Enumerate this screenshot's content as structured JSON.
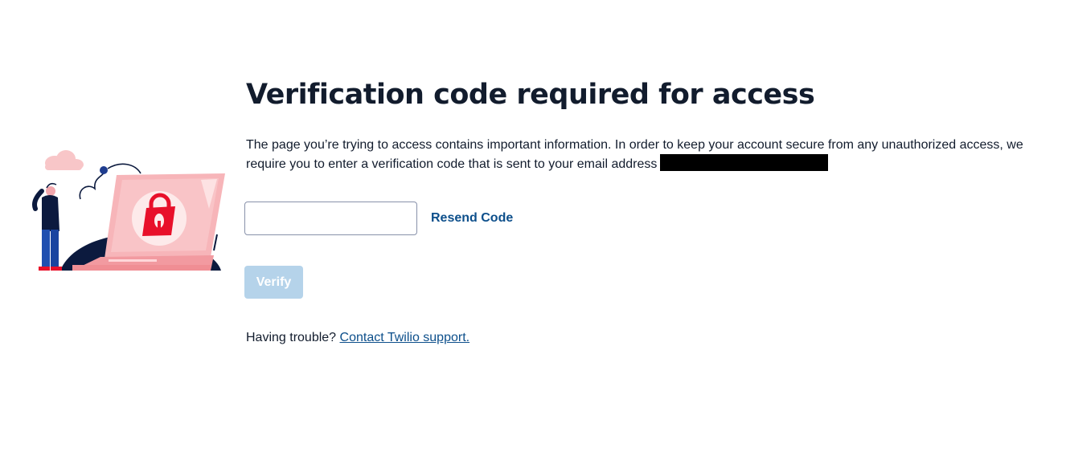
{
  "page": {
    "title": "Verification code required for access",
    "description": "The page you’re trying to access contains important information. In order to keep your account secure from any unauthorized access, we require you to enter a verification code that is sent to your email address"
  },
  "form": {
    "code_value": "",
    "code_placeholder": "",
    "resend_label": "Resend Code",
    "verify_label": "Verify"
  },
  "help": {
    "prefix": "Having trouble?",
    "support_link": "Contact Twilio support."
  },
  "illustration": {
    "icon": "padlock-on-laptop-icon"
  },
  "colors": {
    "link": "#0d4f8b",
    "verify_disabled": "#b5d3ea",
    "title": "#121c2d",
    "illustration_pink": "#f7c1c4",
    "illustration_red": "#e8102a",
    "illustration_navy": "#0c1a3e"
  }
}
